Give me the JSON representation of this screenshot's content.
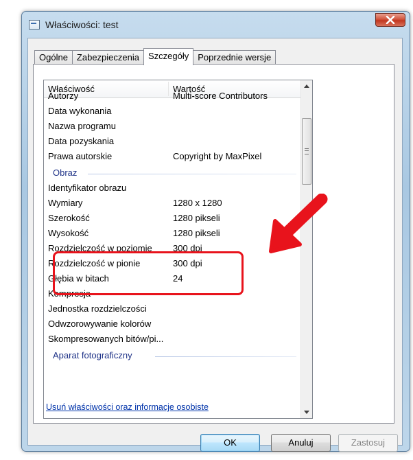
{
  "window": {
    "title": "Właściwości: test"
  },
  "tabs": [
    {
      "label": "Ogólne",
      "active": false
    },
    {
      "label": "Zabezpieczenia",
      "active": false
    },
    {
      "label": "Szczegóły",
      "active": true
    },
    {
      "label": "Poprzednie wersje",
      "active": false
    }
  ],
  "list": {
    "columns": [
      "Właściwość",
      "Wartość"
    ],
    "partial_row": {
      "name": "Autorzy",
      "value": "Multi-score Contributors"
    },
    "rows_before_group": [
      {
        "name": "Data wykonania",
        "value": ""
      },
      {
        "name": "Nazwa programu",
        "value": ""
      },
      {
        "name": "Data pozyskania",
        "value": ""
      },
      {
        "name": "Prawa autorskie",
        "value": "Copyright by MaxPixel"
      }
    ],
    "group_image": "Obraz",
    "image_rows": [
      {
        "name": "Identyfikator obrazu",
        "value": ""
      },
      {
        "name": "Wymiary",
        "value": "1280 x 1280"
      },
      {
        "name": "Szerokość",
        "value": "1280 pikseli"
      },
      {
        "name": "Wysokość",
        "value": "1280 pikseli"
      },
      {
        "name": "Rozdzielczość w poziomie",
        "value": "300 dpi"
      },
      {
        "name": "Rozdzielczość w pionie",
        "value": "300 dpi"
      },
      {
        "name": "Głębia w bitach",
        "value": "24"
      },
      {
        "name": "Kompresja",
        "value": ""
      },
      {
        "name": "Jednostka rozdzielczości",
        "value": ""
      },
      {
        "name": "Odwzorowywanie kolorów",
        "value": ""
      },
      {
        "name": "Skompresowanych bitów/pi...",
        "value": ""
      }
    ],
    "group_camera": "Aparat fotograficzny"
  },
  "link": "Usuń właściwości oraz informacje osobiste",
  "buttons": {
    "ok": "OK",
    "cancel": "Anuluj",
    "apply": "Zastosuj"
  },
  "colors": {
    "highlight": "#e8131c",
    "group_text": "#1e3287",
    "link": "#0033aa"
  }
}
